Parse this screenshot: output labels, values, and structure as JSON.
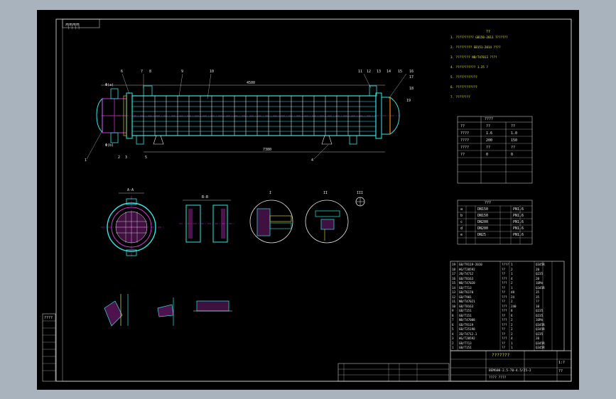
{
  "title_block": {
    "corner_text": "ཀཀཀཀ",
    "drawing_code_row": "????",
    "scale": "1:?",
    "sheet": "??"
  },
  "callouts": [
    "1",
    "2",
    "3",
    "4",
    "5",
    "6",
    "7",
    "8",
    "9",
    "10",
    "11",
    "12",
    "13",
    "14",
    "15",
    "16",
    "17",
    "18",
    "19"
  ],
  "section_labels": {
    "a": "A-A",
    "b": "B-B",
    "i": "I",
    "ii": "II",
    "iii": "III"
  },
  "dimension_labels": {
    "overall_length": "7380",
    "tube_length": "4500",
    "nozzle_a": "Φ(a)",
    "nozzle_b": "Φ(b)"
  },
  "notes": {
    "heading": "??",
    "lines": [
      "1. ?????????? GB150-2011 ???????",
      "2. ????????? GB151-2014 ????",
      "3. ???????? NB/T47013 ????",
      "4. ??????????? 1.25 ?",
      "5. ????????????",
      "6. ????????????",
      "7. ????????"
    ]
  },
  "design_table": {
    "title": "????",
    "rows": [
      [
        "??",
        "??",
        "??"
      ],
      [
        "????",
        "1.6",
        "1.0"
      ],
      [
        "????",
        "200",
        "150"
      ],
      [
        "????",
        "??",
        "??"
      ],
      [
        "??",
        "0",
        "0"
      ]
    ]
  },
  "nozzle_table": {
    "title": "???",
    "rows": [
      [
        "a",
        "DN150",
        "PN1.6"
      ],
      [
        "b",
        "DN150",
        "PN1.6"
      ],
      [
        "c",
        "DN200",
        "PN1.6"
      ],
      [
        "d",
        "DN200",
        "PN1.6"
      ],
      [
        "e",
        "DN25",
        "PN1.6"
      ]
    ]
  },
  "parts_list": {
    "rows": [
      [
        "19",
        "GB/T9119-2010",
        "????",
        "1",
        "Q345R"
      ],
      [
        "18",
        "HG/T20592",
        "??",
        "2",
        "20"
      ],
      [
        "17",
        "JB/T4712",
        "??",
        "1",
        "Q235"
      ],
      [
        "16",
        "GB/T8163",
        "???",
        "4",
        "20"
      ],
      [
        "15",
        "NB/T47020",
        "???",
        "2",
        "16Mn"
      ],
      [
        "14",
        "GB/T713",
        "??",
        "1",
        "Q345R"
      ],
      [
        "13",
        "GB/T6170",
        "??",
        "48",
        "35"
      ],
      [
        "12",
        "GB/T901",
        "???",
        "24",
        "35"
      ],
      [
        "11",
        "NB/T47021",
        "??",
        "2",
        "??"
      ],
      [
        "10",
        "GB/T8163",
        "???",
        "240",
        "10"
      ],
      [
        "9",
        "GB/T151",
        "???",
        "8",
        "Q235"
      ],
      [
        "8",
        "GB/T151",
        "??",
        "6",
        "Q235"
      ],
      [
        "7",
        "NB/T47008",
        "???",
        "2",
        "16Mn"
      ],
      [
        "6",
        "GB/T9119",
        "???",
        "2",
        "Q345R"
      ],
      [
        "5",
        "GB/T25198",
        "??",
        "2",
        "Q345R"
      ],
      [
        "4",
        "JB/T4712.1",
        "??",
        "2",
        "Q235"
      ],
      [
        "3",
        "HG/T20592",
        "???",
        "4",
        "20"
      ],
      [
        "2",
        "GB/T713",
        "??",
        "1",
        "Q345R"
      ],
      [
        "1",
        "GB/T151",
        "??",
        "1",
        "Q345R"
      ]
    ]
  },
  "title_block_main": {
    "name": "???????",
    "code": "BEM600-2.5-70-4.5/25-2",
    "footer": "???? ????"
  }
}
